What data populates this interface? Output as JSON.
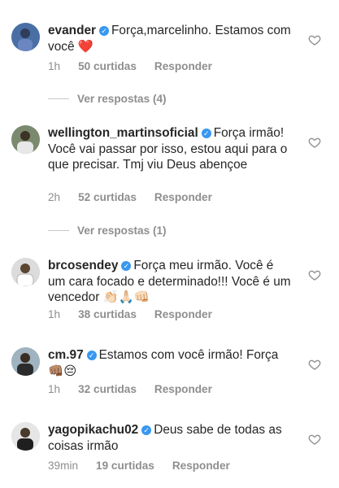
{
  "comments": [
    {
      "username": "evander",
      "text": "Força,marcelinho. Estamos com você",
      "emoji": "❤️",
      "time": "1h",
      "likes": "50 curtidas",
      "reply_label": "Responder"
    },
    {
      "username": "wellington_martinsoficial",
      "text": "Força irmão! Você vai passar por isso, estou aqui para o que precisar. Tmj viu Deus abençoe",
      "emoji": "",
      "time": "2h",
      "likes": "52 curtidas",
      "reply_label": "Responder"
    },
    {
      "username": "brcosendey",
      "text": "Força meu irmão. Você é um cara focado e determinado!!! Você é um vencedor",
      "emoji": "👏🏻🙏🏻👊🏻",
      "time": "1h",
      "likes": "38 curtidas",
      "reply_label": "Responder"
    },
    {
      "username": "cm.97",
      "text": "Estamos com você irmão! Força",
      "emoji": "👊🏽😔",
      "time": "1h",
      "likes": "32 curtidas",
      "reply_label": "Responder"
    },
    {
      "username": "yagopikachu02",
      "text": "Deus sabe de todas as coisas irmão",
      "emoji": "",
      "time": "39min",
      "likes": "19 curtidas",
      "reply_label": "Responder"
    }
  ],
  "view_replies": [
    {
      "label": "Ver respostas (4)"
    },
    {
      "label": "Ver respostas (1)"
    }
  ],
  "icons": {
    "verified": "verified-badge-icon",
    "like": "heart-outline-icon"
  },
  "colors": {
    "verified": "#3897f0",
    "muted": "#8e8e8e",
    "text": "#262626"
  }
}
